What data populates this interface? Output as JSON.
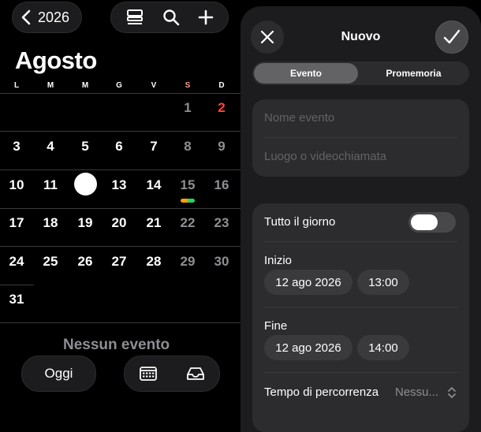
{
  "calendar": {
    "back_label": "2026",
    "month": "Agosto",
    "weekdays": [
      "L",
      "M",
      "M",
      "G",
      "V",
      "S",
      "D"
    ],
    "weeks": [
      [
        "",
        "",
        "",
        "",
        "",
        "1",
        "2"
      ],
      [
        "3",
        "4",
        "5",
        "6",
        "7",
        "8",
        "9"
      ],
      [
        "10",
        "11",
        "12",
        "13",
        "14",
        "15",
        "16"
      ],
      [
        "17",
        "18",
        "19",
        "20",
        "21",
        "22",
        "23"
      ],
      [
        "24",
        "25",
        "26",
        "27",
        "28",
        "29",
        "30"
      ],
      [
        "31",
        "",
        "",
        "",
        "",
        "",
        ""
      ]
    ],
    "today": "12",
    "no_events": "Nessun evento",
    "today_button": "Oggi",
    "event_dot_colors": [
      "#ff9f0a",
      "#30d158"
    ],
    "weekend_color": "#8e8e93",
    "holiday_color": "#ff453a"
  },
  "sheet": {
    "title": "Nuovo",
    "segments": [
      "Evento",
      "Promemoria"
    ],
    "selected_segment": "Evento",
    "event_name_placeholder": "Nome evento",
    "location_placeholder": "Luogo o videochiamata",
    "all_day_label": "Tutto il giorno",
    "all_day_on": false,
    "start_label": "Inizio",
    "start_date": "12 ago 2026",
    "start_time": "13:00",
    "end_label": "Fine",
    "end_date": "12 ago 2026",
    "end_time": "14:00",
    "travel_label": "Tempo di percorrenza",
    "travel_value": "Nessu..."
  },
  "icons": {
    "back": "chevron-left-icon",
    "view": "list-view-icon",
    "search": "search-icon",
    "add": "plus-icon",
    "calendars": "calendar-grid-icon",
    "inbox": "inbox-icon",
    "close": "close-icon",
    "confirm": "checkmark-icon",
    "travel_chevron": "chevron-up-down-icon"
  }
}
